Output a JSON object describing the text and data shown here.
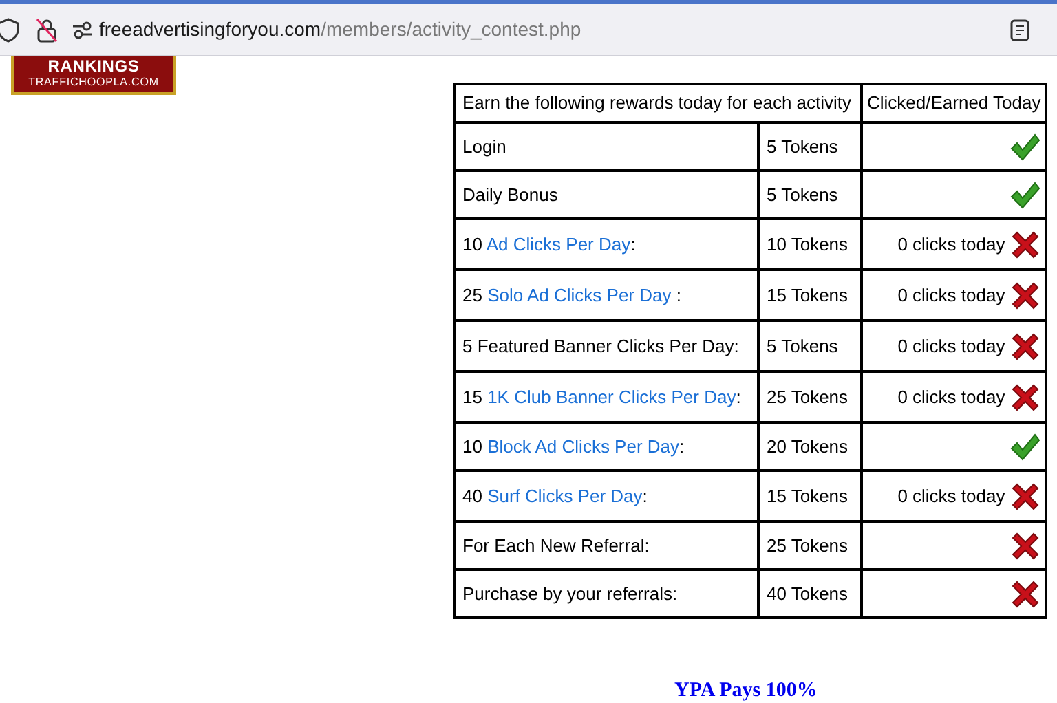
{
  "browser": {
    "url_domain": "freeadvertisingforyou.com",
    "url_path": "/members/activity_contest.php"
  },
  "logo": {
    "title": "RANKINGS",
    "subtitle": "TRAFFICHOOPLA.COM"
  },
  "table": {
    "columns": [
      "Earn the following rewards today for each activity",
      "Clicked/Earned Today"
    ],
    "rows": [
      {
        "activity": [
          {
            "text": "Login",
            "link": false
          }
        ],
        "reward": "5 Tokens",
        "done": true
      },
      {
        "activity": [
          {
            "text": "Daily Bonus",
            "link": false
          }
        ],
        "reward": "5 Tokens",
        "done": true
      },
      {
        "activity": [
          {
            "text": "10 ",
            "link": false
          },
          {
            "text": "Ad Clicks Per Day",
            "link": true
          },
          {
            "text": ":",
            "link": false
          }
        ],
        "reward": "10 Tokens",
        "count": "0 clicks today",
        "done": false
      },
      {
        "activity": [
          {
            "text": "25 ",
            "link": false
          },
          {
            "text": "Solo Ad Clicks Per Day",
            "link": true
          },
          {
            "text": " :",
            "link": false
          }
        ],
        "reward": "15 Tokens",
        "count": "0 clicks today",
        "done": false
      },
      {
        "activity": [
          {
            "text": "5 Featured Banner Clicks Per Day:",
            "link": false
          }
        ],
        "reward": "5 Tokens",
        "count": "0 clicks today",
        "done": false
      },
      {
        "activity": [
          {
            "text": "15 ",
            "link": false
          },
          {
            "text": "1K Club Banner Clicks Per Day",
            "link": true
          },
          {
            "text": ":",
            "link": false
          }
        ],
        "reward": "25 Tokens",
        "count": "0 clicks today",
        "done": false
      },
      {
        "activity": [
          {
            "text": "10 ",
            "link": false
          },
          {
            "text": "Block Ad Clicks Per Day",
            "link": true
          },
          {
            "text": ":",
            "link": false
          }
        ],
        "reward": "20 Tokens",
        "done": true
      },
      {
        "activity": [
          {
            "text": "40 ",
            "link": false
          },
          {
            "text": "Surf Clicks Per Day",
            "link": true
          },
          {
            "text": ":",
            "link": false
          }
        ],
        "reward": "15 Tokens",
        "count": "0 clicks today",
        "done": false
      },
      {
        "activity": [
          {
            "text": "For Each New Referral:",
            "link": false
          }
        ],
        "reward": "25 Tokens",
        "done": false
      },
      {
        "activity": [
          {
            "text": "Purchase by your referrals:",
            "link": false
          }
        ],
        "reward": "40 Tokens",
        "done": false
      }
    ]
  },
  "footer": {
    "heading": "YPA Pays 100%"
  }
}
